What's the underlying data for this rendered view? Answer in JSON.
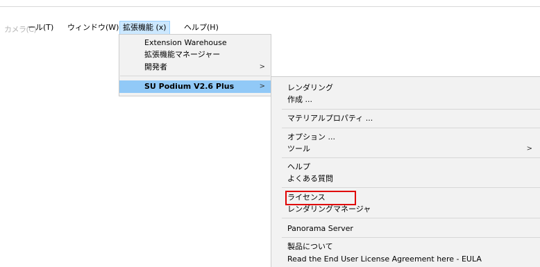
{
  "menubar": {
    "ghost_text": "カメラ(C)",
    "items": [
      {
        "label": "ール(T)"
      },
      {
        "label": "ウィンドウ(W)"
      },
      {
        "label": "拡張機能 (x)"
      },
      {
        "label": "ヘルプ(H)"
      }
    ]
  },
  "extensions_menu": {
    "items": [
      {
        "label": "Extension Warehouse"
      },
      {
        "label": "拡張機能マネージャー"
      },
      {
        "label": "開発者",
        "arrow": ">"
      },
      {
        "label": "SU Podium V2.6 Plus",
        "arrow": ">"
      }
    ]
  },
  "podium_submenu": {
    "items": [
      {
        "label": "レンダリング"
      },
      {
        "label": "作成 ..."
      },
      {
        "label": "マテリアルプロパティ ..."
      },
      {
        "label": "オプション ..."
      },
      {
        "label": "ツール",
        "arrow": ">"
      },
      {
        "label": "ヘルプ"
      },
      {
        "label": "よくある質問"
      },
      {
        "label": "ライセンス"
      },
      {
        "label": "レンダリングマネージャ"
      },
      {
        "label": "Panorama Server"
      },
      {
        "label": "製品について"
      },
      {
        "label": "Read the End User License Agreement here - EULA"
      }
    ]
  },
  "colors": {
    "menu_bg": "#f2f2f2",
    "hover_bg": "#91c9f7",
    "menubar_active_bg": "#cce8ff",
    "annotation_red": "#e00000"
  }
}
